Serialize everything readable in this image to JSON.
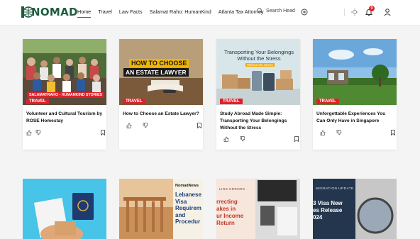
{
  "header": {
    "logo_text": "NOMAD",
    "nav": [
      "Home",
      "Travel",
      "Law Facts",
      "Salamat Raho: HumanKind",
      "Atlanta Tax Attorney"
    ],
    "search_placeholder": "Search Head",
    "notification_count": "0",
    "accent_color": "#e0202a"
  },
  "cards": [
    {
      "overlay": "SALAMATRAHO - HUMANKIND STORIES",
      "tag": "TRAVEL",
      "title": "Volunteer and Cultural Tourism by ROSE Homestay"
    },
    {
      "overlay_line1": "HOW TO CHOOSE",
      "overlay_line2": "AN ESTATE LAWYER",
      "tag": "TRAVEL",
      "title": "How to Choose an Estate Lawyer?"
    },
    {
      "overlay_line1": "Transporting Your Belongings",
      "overlay_line2": "Without the Stress",
      "overlay_sub": "Without the Stress",
      "tag": "TRAVEL",
      "title": "Study Abroad Made Simple: Transporting Your Belongings Without the Stress"
    },
    {
      "tag": "TRAVEL",
      "title": "Unforgettable Experiences You Can Only Have in Singapore"
    }
  ],
  "row2": [
    {
      "text": ""
    },
    {
      "header": "NomadNews",
      "lines": [
        "Lebanese",
        "Visa",
        "Requirem",
        "and",
        "Procedur"
      ]
    },
    {
      "header": "LING ERRORS",
      "lines": [
        "rrecting",
        "akes in",
        "ur Income",
        "Return"
      ]
    },
    {
      "header": "MIGRATION UPDATE",
      "lines": [
        "3 Visa New",
        "es Release",
        "024"
      ]
    }
  ]
}
